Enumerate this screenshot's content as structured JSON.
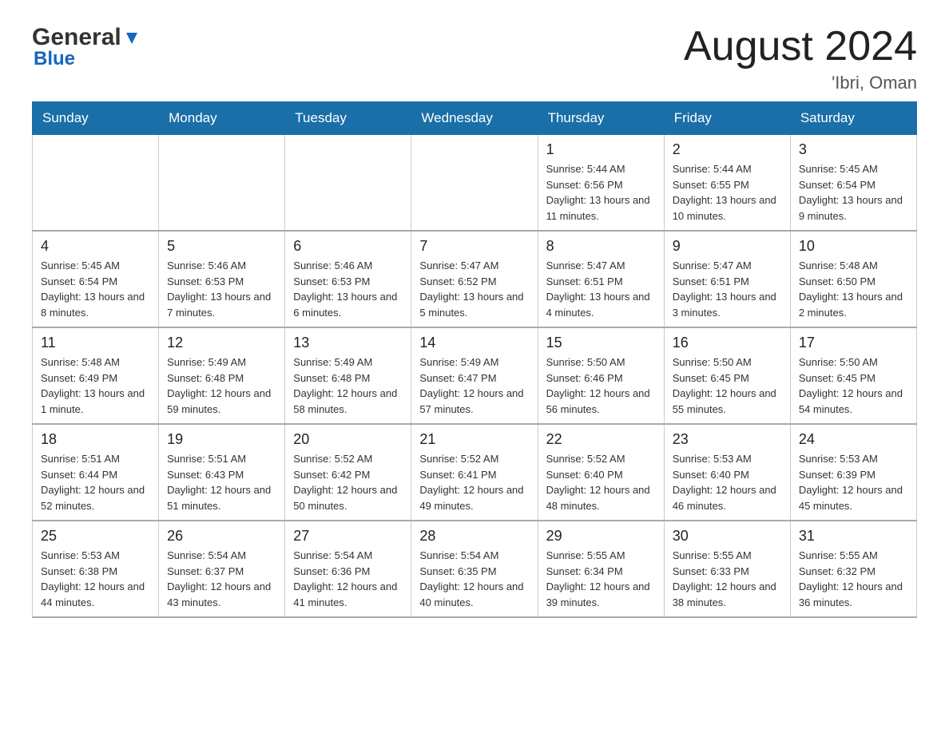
{
  "header": {
    "logo_text1": "General",
    "logo_text2": "Blue",
    "month_year": "August 2024",
    "location": "'Ibri, Oman"
  },
  "days_of_week": [
    "Sunday",
    "Monday",
    "Tuesday",
    "Wednesday",
    "Thursday",
    "Friday",
    "Saturday"
  ],
  "weeks": [
    [
      {
        "day": "",
        "sunrise": "",
        "sunset": "",
        "daylight": ""
      },
      {
        "day": "",
        "sunrise": "",
        "sunset": "",
        "daylight": ""
      },
      {
        "day": "",
        "sunrise": "",
        "sunset": "",
        "daylight": ""
      },
      {
        "day": "",
        "sunrise": "",
        "sunset": "",
        "daylight": ""
      },
      {
        "day": "1",
        "sunrise": "Sunrise: 5:44 AM",
        "sunset": "Sunset: 6:56 PM",
        "daylight": "Daylight: 13 hours and 11 minutes."
      },
      {
        "day": "2",
        "sunrise": "Sunrise: 5:44 AM",
        "sunset": "Sunset: 6:55 PM",
        "daylight": "Daylight: 13 hours and 10 minutes."
      },
      {
        "day": "3",
        "sunrise": "Sunrise: 5:45 AM",
        "sunset": "Sunset: 6:54 PM",
        "daylight": "Daylight: 13 hours and 9 minutes."
      }
    ],
    [
      {
        "day": "4",
        "sunrise": "Sunrise: 5:45 AM",
        "sunset": "Sunset: 6:54 PM",
        "daylight": "Daylight: 13 hours and 8 minutes."
      },
      {
        "day": "5",
        "sunrise": "Sunrise: 5:46 AM",
        "sunset": "Sunset: 6:53 PM",
        "daylight": "Daylight: 13 hours and 7 minutes."
      },
      {
        "day": "6",
        "sunrise": "Sunrise: 5:46 AM",
        "sunset": "Sunset: 6:53 PM",
        "daylight": "Daylight: 13 hours and 6 minutes."
      },
      {
        "day": "7",
        "sunrise": "Sunrise: 5:47 AM",
        "sunset": "Sunset: 6:52 PM",
        "daylight": "Daylight: 13 hours and 5 minutes."
      },
      {
        "day": "8",
        "sunrise": "Sunrise: 5:47 AM",
        "sunset": "Sunset: 6:51 PM",
        "daylight": "Daylight: 13 hours and 4 minutes."
      },
      {
        "day": "9",
        "sunrise": "Sunrise: 5:47 AM",
        "sunset": "Sunset: 6:51 PM",
        "daylight": "Daylight: 13 hours and 3 minutes."
      },
      {
        "day": "10",
        "sunrise": "Sunrise: 5:48 AM",
        "sunset": "Sunset: 6:50 PM",
        "daylight": "Daylight: 13 hours and 2 minutes."
      }
    ],
    [
      {
        "day": "11",
        "sunrise": "Sunrise: 5:48 AM",
        "sunset": "Sunset: 6:49 PM",
        "daylight": "Daylight: 13 hours and 1 minute."
      },
      {
        "day": "12",
        "sunrise": "Sunrise: 5:49 AM",
        "sunset": "Sunset: 6:48 PM",
        "daylight": "Daylight: 12 hours and 59 minutes."
      },
      {
        "day": "13",
        "sunrise": "Sunrise: 5:49 AM",
        "sunset": "Sunset: 6:48 PM",
        "daylight": "Daylight: 12 hours and 58 minutes."
      },
      {
        "day": "14",
        "sunrise": "Sunrise: 5:49 AM",
        "sunset": "Sunset: 6:47 PM",
        "daylight": "Daylight: 12 hours and 57 minutes."
      },
      {
        "day": "15",
        "sunrise": "Sunrise: 5:50 AM",
        "sunset": "Sunset: 6:46 PM",
        "daylight": "Daylight: 12 hours and 56 minutes."
      },
      {
        "day": "16",
        "sunrise": "Sunrise: 5:50 AM",
        "sunset": "Sunset: 6:45 PM",
        "daylight": "Daylight: 12 hours and 55 minutes."
      },
      {
        "day": "17",
        "sunrise": "Sunrise: 5:50 AM",
        "sunset": "Sunset: 6:45 PM",
        "daylight": "Daylight: 12 hours and 54 minutes."
      }
    ],
    [
      {
        "day": "18",
        "sunrise": "Sunrise: 5:51 AM",
        "sunset": "Sunset: 6:44 PM",
        "daylight": "Daylight: 12 hours and 52 minutes."
      },
      {
        "day": "19",
        "sunrise": "Sunrise: 5:51 AM",
        "sunset": "Sunset: 6:43 PM",
        "daylight": "Daylight: 12 hours and 51 minutes."
      },
      {
        "day": "20",
        "sunrise": "Sunrise: 5:52 AM",
        "sunset": "Sunset: 6:42 PM",
        "daylight": "Daylight: 12 hours and 50 minutes."
      },
      {
        "day": "21",
        "sunrise": "Sunrise: 5:52 AM",
        "sunset": "Sunset: 6:41 PM",
        "daylight": "Daylight: 12 hours and 49 minutes."
      },
      {
        "day": "22",
        "sunrise": "Sunrise: 5:52 AM",
        "sunset": "Sunset: 6:40 PM",
        "daylight": "Daylight: 12 hours and 48 minutes."
      },
      {
        "day": "23",
        "sunrise": "Sunrise: 5:53 AM",
        "sunset": "Sunset: 6:40 PM",
        "daylight": "Daylight: 12 hours and 46 minutes."
      },
      {
        "day": "24",
        "sunrise": "Sunrise: 5:53 AM",
        "sunset": "Sunset: 6:39 PM",
        "daylight": "Daylight: 12 hours and 45 minutes."
      }
    ],
    [
      {
        "day": "25",
        "sunrise": "Sunrise: 5:53 AM",
        "sunset": "Sunset: 6:38 PM",
        "daylight": "Daylight: 12 hours and 44 minutes."
      },
      {
        "day": "26",
        "sunrise": "Sunrise: 5:54 AM",
        "sunset": "Sunset: 6:37 PM",
        "daylight": "Daylight: 12 hours and 43 minutes."
      },
      {
        "day": "27",
        "sunrise": "Sunrise: 5:54 AM",
        "sunset": "Sunset: 6:36 PM",
        "daylight": "Daylight: 12 hours and 41 minutes."
      },
      {
        "day": "28",
        "sunrise": "Sunrise: 5:54 AM",
        "sunset": "Sunset: 6:35 PM",
        "daylight": "Daylight: 12 hours and 40 minutes."
      },
      {
        "day": "29",
        "sunrise": "Sunrise: 5:55 AM",
        "sunset": "Sunset: 6:34 PM",
        "daylight": "Daylight: 12 hours and 39 minutes."
      },
      {
        "day": "30",
        "sunrise": "Sunrise: 5:55 AM",
        "sunset": "Sunset: 6:33 PM",
        "daylight": "Daylight: 12 hours and 38 minutes."
      },
      {
        "day": "31",
        "sunrise": "Sunrise: 5:55 AM",
        "sunset": "Sunset: 6:32 PM",
        "daylight": "Daylight: 12 hours and 36 minutes."
      }
    ]
  ]
}
